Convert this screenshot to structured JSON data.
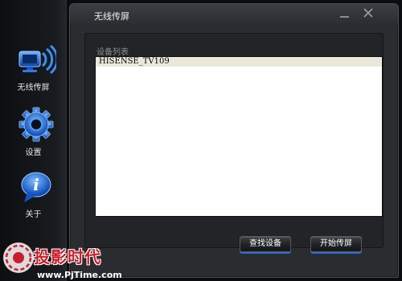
{
  "sidebar": {
    "items": [
      {
        "label": "无线传屏",
        "icon": "wireless-screen-icon"
      },
      {
        "label": "设置",
        "icon": "gear-icon"
      },
      {
        "label": "关于",
        "icon": "info-icon"
      }
    ]
  },
  "window": {
    "title": "无线传屏",
    "device_list_label": "设备列表",
    "devices": [
      "HISENSE_TV109"
    ],
    "buttons": {
      "find": "查找设备",
      "start": "开始传屏"
    }
  },
  "watermark": {
    "title": "投影时代",
    "url": "www.PjTime.com"
  },
  "colors": {
    "accent_blue": "#2a6fd0",
    "selected_row": "#ebe8da",
    "watermark_red": "#cc1d2b"
  }
}
